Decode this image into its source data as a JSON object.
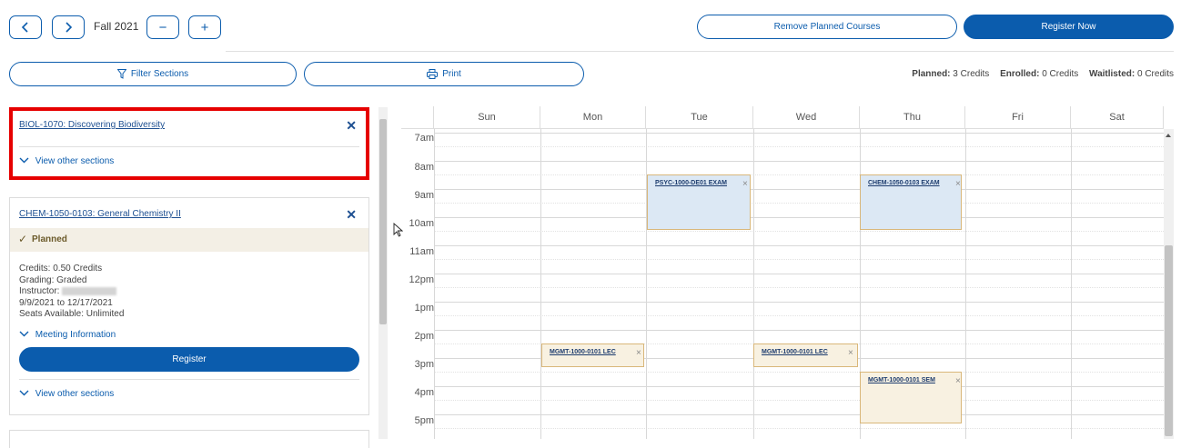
{
  "toolbar": {
    "term": "Fall 2021",
    "prev_icon": "chevron-left-icon",
    "next_icon": "chevron-right-icon",
    "minus_label": "−",
    "plus_label": "+",
    "remove_planned_label": "Remove Planned Courses",
    "register_now_label": "Register Now",
    "filter_label": "Filter Sections",
    "print_label": "Print",
    "accent_color": "#0b5cad"
  },
  "summary": {
    "planned_label": "Planned:",
    "planned_value": "3 Credits",
    "enrolled_label": "Enrolled:",
    "enrolled_value": "0 Credits",
    "waitlisted_label": "Waitlisted:",
    "waitlisted_value": "0 Credits"
  },
  "courses": [
    {
      "title": "BIOL-1070: Discovering Biodiversity",
      "remove_label": "✕",
      "view_other_label": "View other sections",
      "highlight_color": "#e60000"
    },
    {
      "title": "CHEM-1050-0103: General Chemistry II",
      "remove_label": "✕",
      "status": "Planned",
      "credits": "Credits: 0.50 Credits",
      "grading": "Grading: Graded",
      "instructor": "Instructor:",
      "dates": "9/9/2021 to 12/17/2021",
      "seats": "Seats Available:  Unlimited",
      "meeting_label": "Meeting Information",
      "register_label": "Register",
      "view_other_label": "View other sections"
    }
  ],
  "calendar": {
    "days": [
      "Sun",
      "Mon",
      "Tue",
      "Wed",
      "Thu",
      "Fri",
      "Sat"
    ],
    "times": [
      "7am",
      "8am",
      "9am",
      "10am",
      "11am",
      "12pm",
      "1pm",
      "2pm",
      "3pm",
      "4pm",
      "5pm"
    ],
    "events": [
      {
        "label": "PSYC-1000-DE01 EXAM",
        "day": "Tue",
        "start": "8:15",
        "end": "10:00",
        "color": "#dce8f4"
      },
      {
        "label": "CHEM-1050-0103 EXAM",
        "day": "Thu",
        "start": "8:15",
        "end": "10:00",
        "color": "#dce8f4"
      },
      {
        "label": "MGMT-1000-0101 LEC",
        "day": "Mon",
        "start": "2:15",
        "end": "3:00",
        "color": "#f8f1e1"
      },
      {
        "label": "MGMT-1000-0101 LEC",
        "day": "Wed",
        "start": "2:15",
        "end": "3:00",
        "color": "#f8f1e1"
      },
      {
        "label": "MGMT-1000-0101 SEM",
        "day": "Thu",
        "start": "3:15",
        "end": "5:00",
        "color": "#f8f1e1"
      }
    ]
  }
}
